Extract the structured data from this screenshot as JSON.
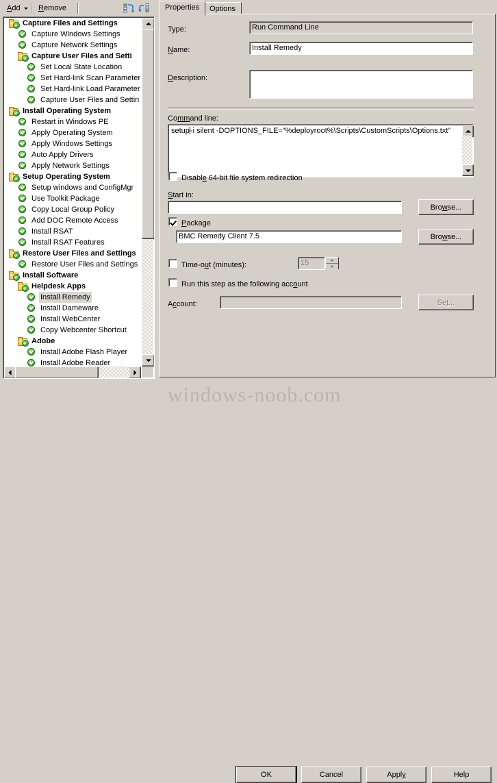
{
  "toolbar": {
    "add_label": "Add",
    "add_accel": "A",
    "remove_label": "Remove",
    "remove_accel": "R",
    "icons": [
      "collapse-all-icon",
      "expand-all-icon"
    ]
  },
  "tree": {
    "nodes": [
      {
        "label": "Capture Files and Settings",
        "type": "folder",
        "depth": 0
      },
      {
        "label": "Capture Windows Settings",
        "type": "step",
        "depth": 1
      },
      {
        "label": "Capture Network Settings",
        "type": "step",
        "depth": 1
      },
      {
        "label": "Capture User Files and Setti",
        "type": "folder",
        "depth": 1
      },
      {
        "label": "Set Local State Location",
        "type": "step",
        "depth": 2
      },
      {
        "label": "Set Hard-link Scan Parameter",
        "type": "step",
        "depth": 2
      },
      {
        "label": "Set Hard-link Load Parameter",
        "type": "step",
        "depth": 2
      },
      {
        "label": "Capture User Files and Settin",
        "type": "step",
        "depth": 2
      },
      {
        "label": "Install Operating System",
        "type": "folder",
        "depth": 0
      },
      {
        "label": "Restart in Windows PE",
        "type": "step",
        "depth": 1
      },
      {
        "label": "Apply Operating System",
        "type": "step",
        "depth": 1
      },
      {
        "label": "Apply Windows Settings",
        "type": "step",
        "depth": 1
      },
      {
        "label": "Auto Apply Drivers",
        "type": "step",
        "depth": 1
      },
      {
        "label": "Apply Network Settings",
        "type": "step",
        "depth": 1
      },
      {
        "label": "Setup Operating System",
        "type": "folder",
        "depth": 0
      },
      {
        "label": "Setup windows and ConfigMgr",
        "type": "step",
        "depth": 1
      },
      {
        "label": "Use Toolkit Package",
        "type": "step",
        "depth": 1
      },
      {
        "label": "Copy Local Group Policy",
        "type": "step",
        "depth": 1
      },
      {
        "label": "Add DOC Remote Access",
        "type": "step",
        "depth": 1
      },
      {
        "label": "Install RSAT",
        "type": "step",
        "depth": 1
      },
      {
        "label": "Install RSAT Features",
        "type": "step",
        "depth": 1
      },
      {
        "label": "Restore User Files and Settings",
        "type": "folder",
        "depth": 0
      },
      {
        "label": "Restore User Files and Settings",
        "type": "step",
        "depth": 1
      },
      {
        "label": "Install Software",
        "type": "folder",
        "depth": 0
      },
      {
        "label": "Helpdesk Apps",
        "type": "folder",
        "depth": 1
      },
      {
        "label": "Install Remedy",
        "type": "step",
        "depth": 2,
        "selected": true
      },
      {
        "label": "Install Dameware",
        "type": "step",
        "depth": 2
      },
      {
        "label": "Install WebCenter",
        "type": "step",
        "depth": 2
      },
      {
        "label": "Copy Webcenter Shortcut",
        "type": "step",
        "depth": 2
      },
      {
        "label": "Adobe",
        "type": "folder",
        "depth": 1
      },
      {
        "label": "Install Adobe Flash Player",
        "type": "step",
        "depth": 2
      },
      {
        "label": "Install Adobe Reader",
        "type": "step",
        "depth": 2
      }
    ]
  },
  "tabs": [
    {
      "label": "Properties",
      "active": true
    },
    {
      "label": "Options",
      "active": false
    }
  ],
  "properties": {
    "type_label": "Type:",
    "type_value": "Run Command Line",
    "name_label": "Name:",
    "name_accel": "N",
    "name_value": "Install Remedy",
    "description_label": "Description:",
    "description_accel": "D",
    "description_value": "",
    "command_line_label": "Command line:",
    "command_line_accel": "mm",
    "command_line_value_before_caret": "setup",
    "command_line_value_after_caret": "-i silent -DOPTIONS_FILE=\"%deployroot%\\Scripts\\CustomScripts\\Options.txt\"",
    "command_line_full": "setup -i silent -DOPTIONS_FILE=\"%deployroot%\\Scripts\\CustomScripts\\Options.txt\"",
    "disable_redirection_label": "Disable 64-bit file system redirection",
    "disable_redirection_checked": false,
    "start_in_label": "Start in:",
    "start_in_value": "",
    "start_in_browse_label": "Browse...",
    "package_label": "Package",
    "package_checked": true,
    "package_value": "BMC Remedy Client 7.5",
    "package_browse_label": "Browse...",
    "timeout_label": "Time-out (minutes):",
    "timeout_checked": false,
    "timeout_value": "15",
    "run_as_label": "Run this step as the following account",
    "run_as_checked": false,
    "account_label": "Account:",
    "account_value": "",
    "account_set_label": "Set..."
  },
  "footer": {
    "ok_label": "OK",
    "cancel_label": "Cancel",
    "apply_label": "Apply",
    "help_label": "Help"
  },
  "watermark": "windows-noob.com",
  "colors": {
    "face": "#d4d0c8",
    "field": "#ffffff",
    "selection": "#d8d8d0",
    "accent": "#2d8c1f"
  }
}
